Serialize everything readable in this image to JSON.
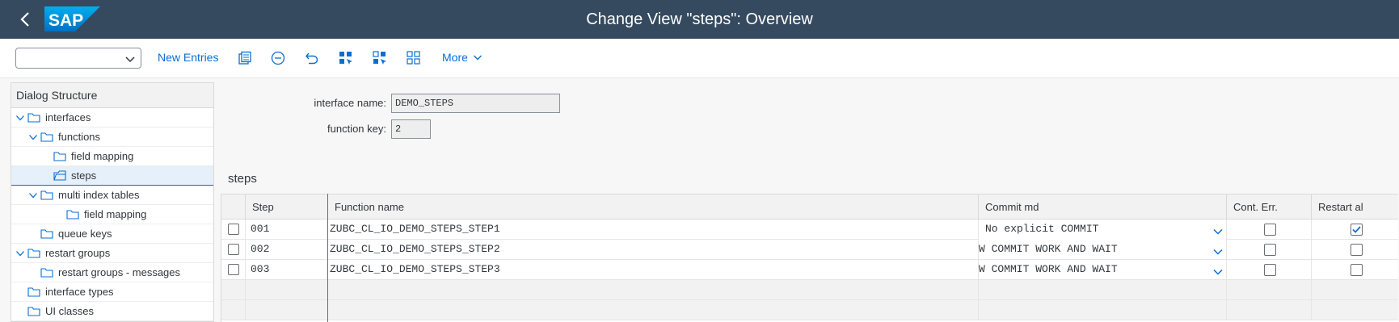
{
  "shell": {
    "title": "Change View \"steps\": Overview",
    "logo_text": "SAP",
    "brand_color": "#354a5f"
  },
  "toolbar": {
    "select_value": "",
    "new_entries_label": "New Entries",
    "more_label": "More",
    "icons": [
      "copy-as-icon",
      "delete-icon",
      "undo-icon",
      "select-all-icon",
      "select-block-icon",
      "deselect-all-icon"
    ]
  },
  "tree": {
    "header": "Dialog Structure",
    "items": [
      {
        "label": "interfaces",
        "level": 0,
        "expanded": true
      },
      {
        "label": "functions",
        "level": 1,
        "expanded": true
      },
      {
        "label": "field mapping",
        "level": 2
      },
      {
        "label": "steps",
        "level": 2,
        "selected": true
      },
      {
        "label": "multi index tables",
        "level": 1,
        "expanded": true
      },
      {
        "label": "field mapping",
        "level": 3
      },
      {
        "label": "queue keys",
        "level": 1
      },
      {
        "label": "restart groups",
        "level": 0,
        "expanded": true
      },
      {
        "label": "restart groups - messages",
        "level": 1
      },
      {
        "label": "interface types",
        "level": 0
      },
      {
        "label": "UI classes",
        "level": 0
      }
    ]
  },
  "header_fields": {
    "interface_name_label": "interface name:",
    "interface_name_value": "DEMO_STEPS",
    "function_key_label": "function key:",
    "function_key_value": "2"
  },
  "section": {
    "title": "steps"
  },
  "table": {
    "columns": [
      "Step",
      "Function name",
      "Commit md",
      "Cont. Err.",
      "Restart al"
    ],
    "rows": [
      {
        "step": "001",
        "function": "ZUBC_CL_IO_DEMO_STEPS_STEP1",
        "commit": "No explicit COMMIT",
        "cont_err": false,
        "restart": true
      },
      {
        "step": "002",
        "function": "ZUBC_CL_IO_DEMO_STEPS_STEP2",
        "commit": "W COMMIT WORK AND WAIT",
        "cont_err": false,
        "restart": false
      },
      {
        "step": "003",
        "function": "ZUBC_CL_IO_DEMO_STEPS_STEP3",
        "commit": "W COMMIT WORK AND WAIT",
        "cont_err": false,
        "restart": false
      }
    ]
  }
}
